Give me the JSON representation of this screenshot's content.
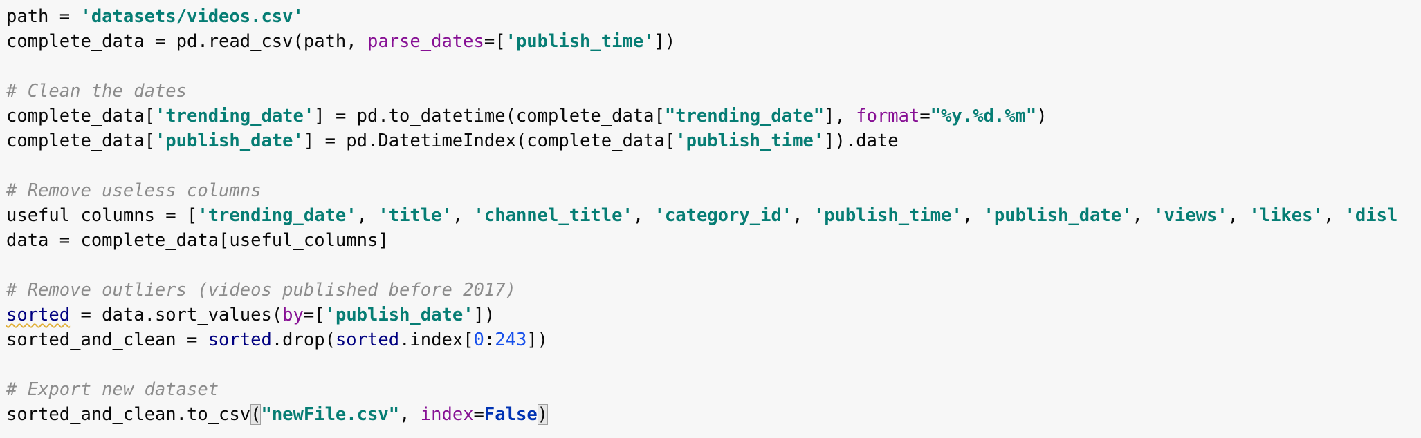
{
  "editor": {
    "lines": [
      [
        {
          "t": "path = ",
          "k": "plain"
        },
        {
          "t": "'datasets/videos.csv'",
          "k": "str"
        }
      ],
      [
        {
          "t": "complete_data = pd.read_csv(path, ",
          "k": "plain"
        },
        {
          "t": "parse_dates",
          "k": "kw"
        },
        {
          "t": "=[",
          "k": "plain"
        },
        {
          "t": "'publish_time'",
          "k": "str"
        },
        {
          "t": "])",
          "k": "plain"
        }
      ],
      [],
      [
        {
          "t": "# Clean the dates",
          "k": "cmt"
        }
      ],
      [
        {
          "t": "complete_data[",
          "k": "plain"
        },
        {
          "t": "'trending_date'",
          "k": "str"
        },
        {
          "t": "] = pd.to_datetime(complete_data[",
          "k": "plain"
        },
        {
          "t": "\"trending_date\"",
          "k": "str"
        },
        {
          "t": "], ",
          "k": "plain"
        },
        {
          "t": "format",
          "k": "kw"
        },
        {
          "t": "=",
          "k": "plain"
        },
        {
          "t": "\"%y.%d.%m\"",
          "k": "str"
        },
        {
          "t": ")",
          "k": "plain"
        }
      ],
      [
        {
          "t": "complete_data[",
          "k": "plain"
        },
        {
          "t": "'publish_date'",
          "k": "str"
        },
        {
          "t": "] = pd.DatetimeIndex(complete_data[",
          "k": "plain"
        },
        {
          "t": "'publish_time'",
          "k": "str"
        },
        {
          "t": "]).date",
          "k": "plain"
        }
      ],
      [],
      [
        {
          "t": "# Remove useless columns",
          "k": "cmt"
        }
      ],
      [
        {
          "t": "useful_columns = [",
          "k": "plain"
        },
        {
          "t": "'trending_date'",
          "k": "str"
        },
        {
          "t": ", ",
          "k": "plain"
        },
        {
          "t": "'title'",
          "k": "str"
        },
        {
          "t": ", ",
          "k": "plain"
        },
        {
          "t": "'channel_title'",
          "k": "str"
        },
        {
          "t": ", ",
          "k": "plain"
        },
        {
          "t": "'category_id'",
          "k": "str"
        },
        {
          "t": ", ",
          "k": "plain"
        },
        {
          "t": "'publish_time'",
          "k": "str"
        },
        {
          "t": ", ",
          "k": "plain"
        },
        {
          "t": "'publish_date'",
          "k": "str"
        },
        {
          "t": ", ",
          "k": "plain"
        },
        {
          "t": "'views'",
          "k": "str"
        },
        {
          "t": ", ",
          "k": "plain"
        },
        {
          "t": "'likes'",
          "k": "str"
        },
        {
          "t": ", ",
          "k": "plain"
        },
        {
          "t": "'disl",
          "k": "str"
        }
      ],
      [
        {
          "t": "data = complete_data[useful_columns]",
          "k": "plain"
        }
      ],
      [],
      [
        {
          "t": "# Remove outliers (videos published before 2017)",
          "k": "cmt"
        }
      ],
      [
        {
          "t": "sorted",
          "k": "builtin-warn"
        },
        {
          "t": " = data.sort_values(",
          "k": "plain"
        },
        {
          "t": "by",
          "k": "kw"
        },
        {
          "t": "=[",
          "k": "plain"
        },
        {
          "t": "'publish_date'",
          "k": "str"
        },
        {
          "t": "])",
          "k": "plain"
        }
      ],
      [
        {
          "t": "sorted_and_clean = ",
          "k": "plain"
        },
        {
          "t": "sorted",
          "k": "builtin"
        },
        {
          "t": ".drop(",
          "k": "plain"
        },
        {
          "t": "sorted",
          "k": "builtin"
        },
        {
          "t": ".index[",
          "k": "plain"
        },
        {
          "t": "0",
          "k": "num"
        },
        {
          "t": ":",
          "k": "plain"
        },
        {
          "t": "243",
          "k": "num"
        },
        {
          "t": "])",
          "k": "plain"
        }
      ],
      [],
      [
        {
          "t": "# Export new dataset",
          "k": "cmt"
        }
      ],
      [
        {
          "t": "sorted_and_clean.to_csv",
          "k": "plain"
        },
        {
          "t": "(",
          "k": "brace-match"
        },
        {
          "t": "\"newFile.csv\"",
          "k": "str"
        },
        {
          "t": ", ",
          "k": "plain"
        },
        {
          "t": "index",
          "k": "kw"
        },
        {
          "t": "=",
          "k": "plain"
        },
        {
          "t": "False",
          "k": "bool"
        },
        {
          "t": ")",
          "k": "brace-match"
        }
      ]
    ]
  }
}
